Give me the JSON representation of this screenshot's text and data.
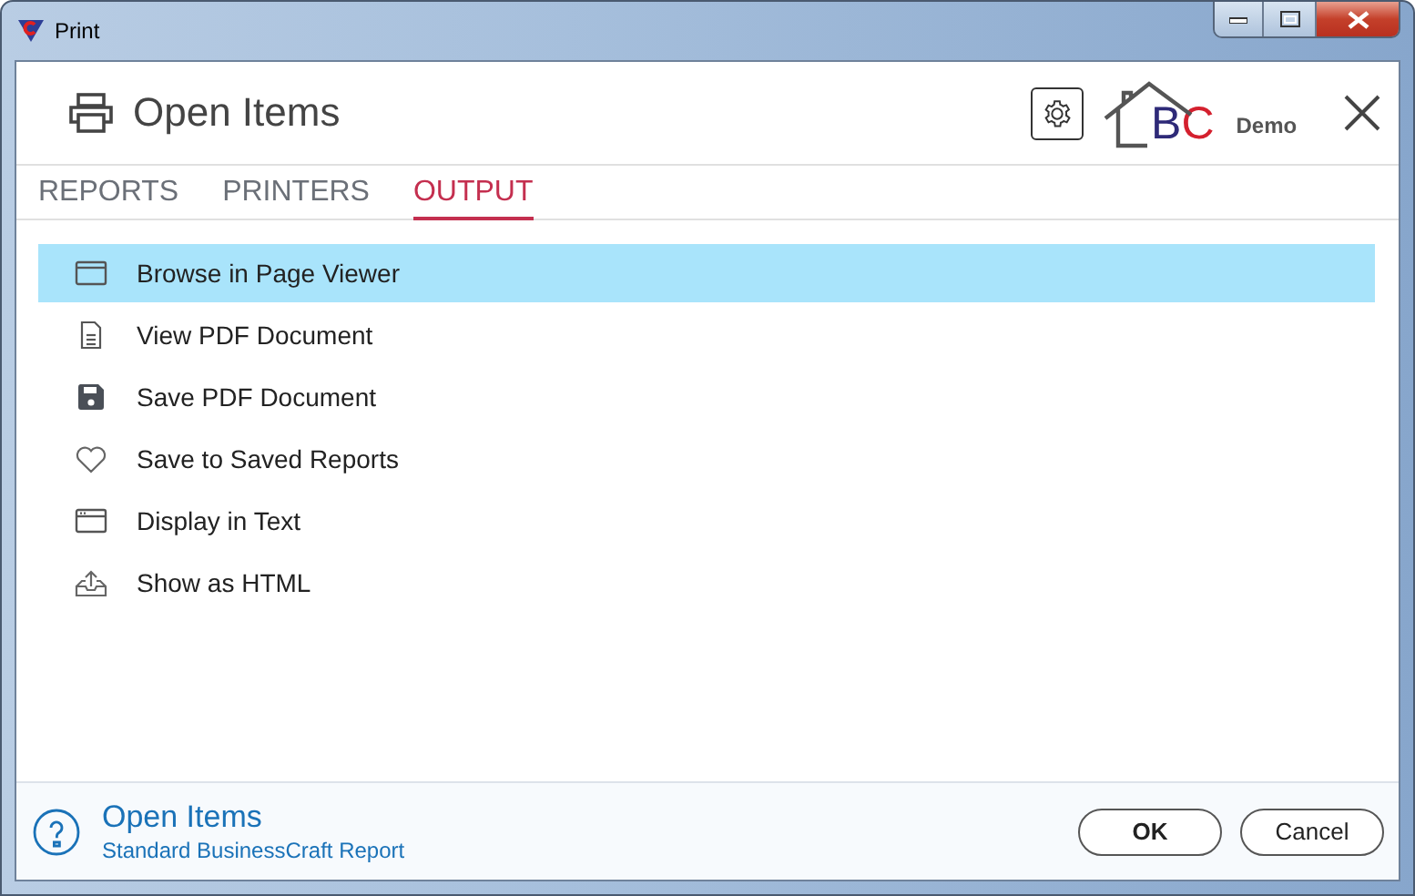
{
  "window": {
    "title": "Print"
  },
  "header": {
    "title": "Open Items",
    "logo": {
      "letters": [
        {
          "text": "B",
          "color": "#2e2a78"
        },
        {
          "text": "C",
          "color": "#d4202e"
        }
      ],
      "edition": "Demo"
    }
  },
  "tabs": [
    {
      "label": "REPORTS",
      "selected": false
    },
    {
      "label": "PRINTERS",
      "selected": false
    },
    {
      "label": "OUTPUT",
      "selected": true
    }
  ],
  "outputs": [
    {
      "kind": "viewer",
      "label": "Browse in Page Viewer",
      "selected": true
    },
    {
      "kind": "document",
      "label": "View PDF Document",
      "selected": false
    },
    {
      "kind": "disk",
      "label": "Save PDF Document",
      "selected": false
    },
    {
      "kind": "heart",
      "label": "Save to Saved Reports",
      "selected": false
    },
    {
      "kind": "text",
      "label": "Display in Text",
      "selected": false
    },
    {
      "kind": "export",
      "label": "Show as HTML",
      "selected": false
    }
  ],
  "footer": {
    "title": "Open Items",
    "subtitle": "Standard BusinessCraft Report"
  },
  "buttons": [
    "OK",
    "Cancel"
  ]
}
